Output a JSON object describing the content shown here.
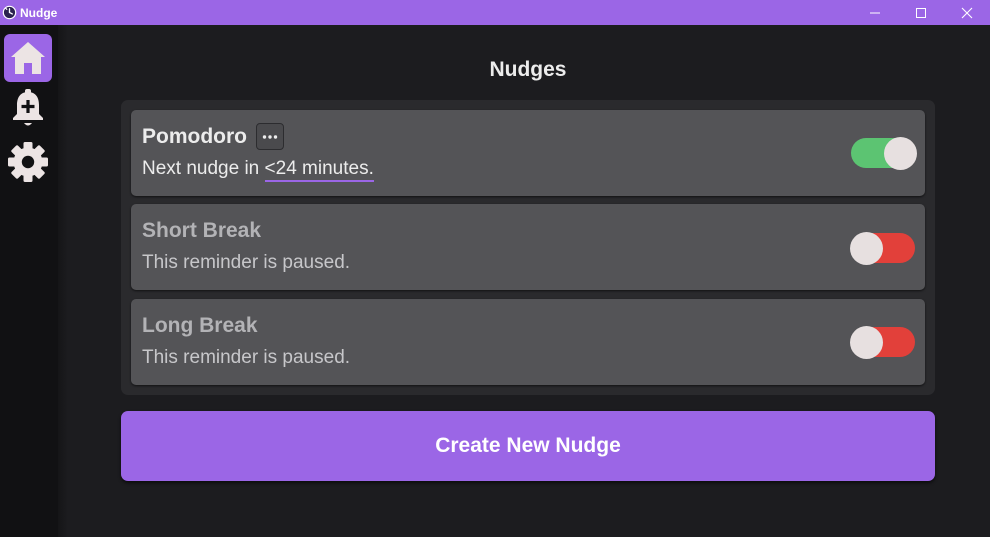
{
  "window": {
    "title": "Nudge",
    "app_icon": "clock-icon",
    "controls": [
      "minimize-icon",
      "maximize-icon",
      "close-icon"
    ]
  },
  "sidebar": {
    "items": [
      {
        "icon": "home-icon",
        "active": true
      },
      {
        "icon": "bell-plus-icon",
        "active": false
      },
      {
        "icon": "gear-icon",
        "active": false
      }
    ]
  },
  "main": {
    "title": "Nudges",
    "nudges": [
      {
        "name": "Pomodoro",
        "enabled": true,
        "status_prefix": "Next nudge in ",
        "status_time": "<24 minutes."
      },
      {
        "name": "Short Break",
        "enabled": false,
        "status": "This reminder is paused."
      },
      {
        "name": "Long Break",
        "enabled": false,
        "status": "This reminder is paused."
      }
    ],
    "create_button": "Create New Nudge"
  },
  "colors": {
    "accent": "#9b66e6",
    "toggle_on": "#5cc472",
    "toggle_off": "#e2403a",
    "card": "#545457",
    "background": "#1c1c1f"
  }
}
